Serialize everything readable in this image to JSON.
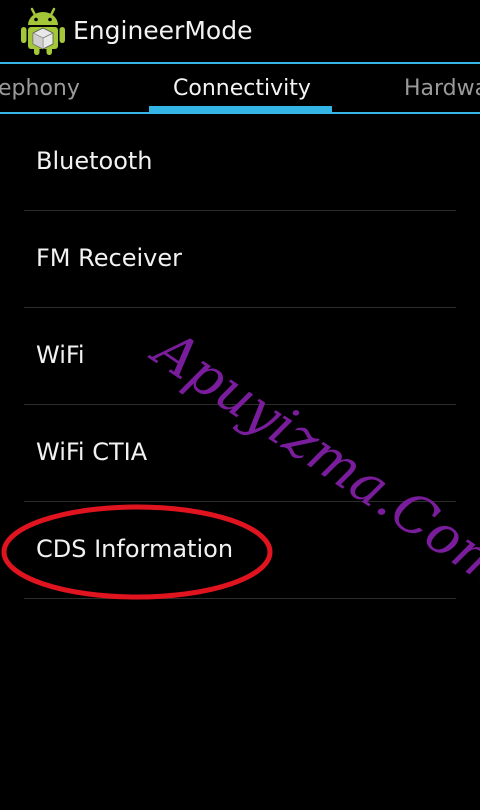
{
  "action_bar": {
    "title": "EngineerMode",
    "icon": "android-robot-icon"
  },
  "tabs": [
    {
      "label": "Telephony",
      "visible_text": "ephony",
      "selected": false
    },
    {
      "label": "Connectivity",
      "visible_text": "Connectivity",
      "selected": true
    },
    {
      "label": "Hardware",
      "visible_text": "Hardwa",
      "selected": false
    }
  ],
  "list": {
    "items": [
      {
        "label": "Bluetooth"
      },
      {
        "label": "FM Receiver"
      },
      {
        "label": "WiFi"
      },
      {
        "label": "WiFi CTIA"
      },
      {
        "label": "CDS Information"
      }
    ]
  },
  "watermark": "Apuyizma.Com",
  "colors": {
    "background": "#000000",
    "accent": "#33b5e5",
    "text_primary": "#f2f2f2",
    "text_inactive": "#9a9a9a",
    "highlight_ellipse": "#e0141e",
    "watermark": "#7a1d9c"
  }
}
